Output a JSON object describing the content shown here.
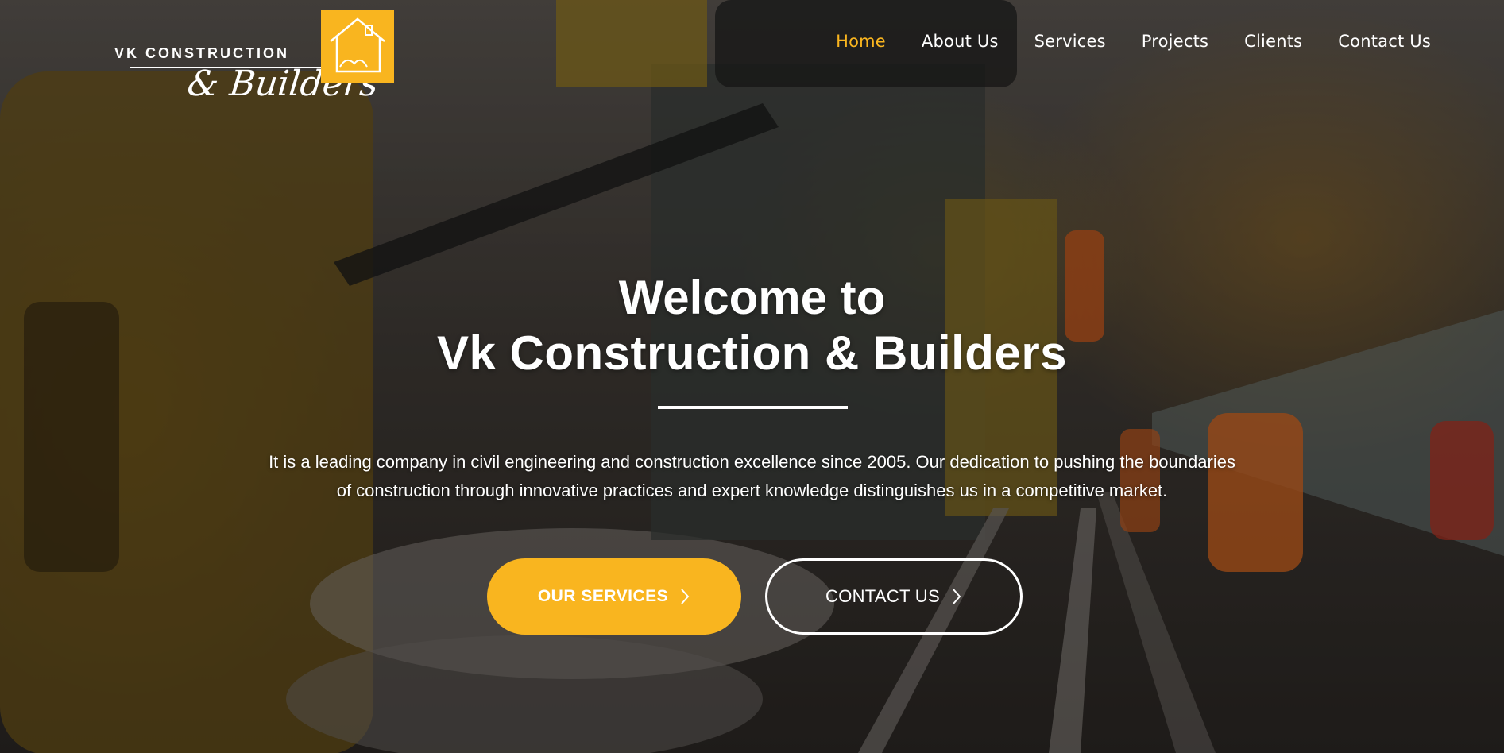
{
  "brand": {
    "line1": "VK CONSTRUCTION",
    "line2": "& Builders",
    "accent_color": "#f9b51f",
    "icon": "house-outline-icon"
  },
  "nav": {
    "items": [
      {
        "label": "Home",
        "active": true
      },
      {
        "label": "About Us",
        "active": false
      },
      {
        "label": "Services",
        "active": false
      },
      {
        "label": "Projects",
        "active": false
      },
      {
        "label": "Clients",
        "active": false
      },
      {
        "label": "Contact Us",
        "active": false
      }
    ]
  },
  "hero": {
    "title_line1": "Welcome to",
    "title_line2": "Vk Construction & Builders",
    "description": "It is a leading company in civil engineering and construction excellence since 2005. Our dedication to pushing the boundaries of construction through innovative practices and expert knowledge distinguishes us in a competitive market.",
    "primary_button": {
      "label": "OUR SERVICES",
      "icon": "chevron-right-icon"
    },
    "secondary_button": {
      "label": "CONTACT US",
      "icon": "chevron-right-icon"
    }
  }
}
